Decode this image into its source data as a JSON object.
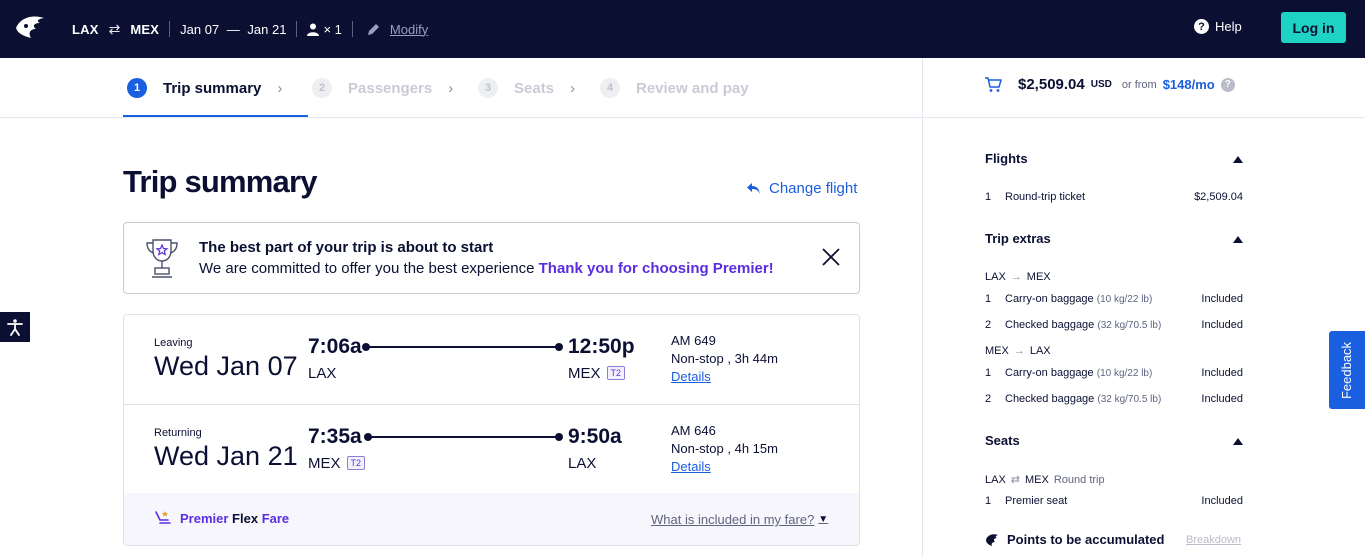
{
  "header": {
    "origin": "LAX",
    "destination": "MEX",
    "depart_date": "Jan 07",
    "return_date": "Jan 21",
    "date_dash": "—",
    "passengers": "× 1",
    "modify_label": "Modify",
    "help_label": "Help",
    "login_label": "Log in"
  },
  "steps": [
    {
      "num": "1",
      "label": "Trip summary",
      "state": "active"
    },
    {
      "num": "2",
      "label": "Passengers",
      "state": "inactive"
    },
    {
      "num": "3",
      "label": "Seats",
      "state": "inactive"
    },
    {
      "num": "4",
      "label": "Review and pay",
      "state": "inactive"
    }
  ],
  "cart": {
    "total": "$2,509.04",
    "currency": "USD",
    "or_from": "or from",
    "monthly": "$148/mo",
    "info": "?"
  },
  "main": {
    "title": "Trip summary",
    "change_flight": "Change flight",
    "banner": {
      "heading": "The best part of your trip is about to start",
      "text": "We are committed to offer you the best experience",
      "accent": "Thank you for choosing Premier!"
    }
  },
  "flights": [
    {
      "label": "Leaving",
      "date": "Wed Jan 07",
      "dep_time": "7:06a",
      "dep_code": "LAX",
      "dep_terminal": "",
      "arr_time": "12:50p",
      "arr_code": "MEX",
      "arr_terminal": "T2",
      "flight_no": "AM 649",
      "stops": "Non-stop , 3h 44m",
      "details": "Details"
    },
    {
      "label": "Returning",
      "date": "Wed Jan 21",
      "dep_time": "7:35a",
      "dep_code": "MEX",
      "dep_terminal": "T2",
      "arr_time": "9:50a",
      "arr_code": "LAX",
      "arr_terminal": "",
      "flight_no": "AM 646",
      "stops": "Non-stop , 4h 15m",
      "details": "Details"
    }
  ],
  "fare": {
    "word1": "Premier",
    "word2": "Flex",
    "word3": "Fare",
    "included_link": "What is included in my fare?"
  },
  "sidebar": {
    "flights_title": "Flights",
    "flights_items": [
      {
        "n": "1",
        "label": "Round-trip ticket",
        "value": "$2,509.04"
      }
    ],
    "extras_title": "Trip extras",
    "extras_groups": [
      {
        "from": "LAX",
        "to": "MEX",
        "items": [
          {
            "n": "1",
            "label": "Carry-on baggage",
            "sub": "(10 kg/22 lb)",
            "value": "Included"
          },
          {
            "n": "2",
            "label": "Checked baggage",
            "sub": "(32 kg/70.5 lb)",
            "value": "Included"
          }
        ]
      },
      {
        "from": "MEX",
        "to": "LAX",
        "items": [
          {
            "n": "1",
            "label": "Carry-on baggage",
            "sub": "(10 kg/22 lb)",
            "value": "Included"
          },
          {
            "n": "2",
            "label": "Checked baggage",
            "sub": "(32 kg/70.5 lb)",
            "value": "Included"
          }
        ]
      }
    ],
    "seats_title": "Seats",
    "seats_route": {
      "from": "LAX",
      "to": "MEX",
      "type": "Round trip"
    },
    "seats_items": [
      {
        "n": "1",
        "label": "Premier seat",
        "value": "Included"
      }
    ],
    "points_label": "Points to be accumulated",
    "breakdown_label": "Breakdown"
  },
  "feedback_label": "Feedback",
  "colors": {
    "navy": "#0b1033",
    "accent_blue": "#1a5fe0",
    "login_teal": "#1fd3c4",
    "purple": "#5a2ee0"
  }
}
